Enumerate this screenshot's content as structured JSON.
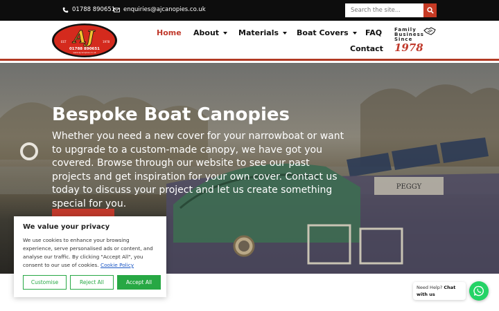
{
  "topbar": {
    "phone": "01788 890651",
    "email": "enquiries@ajcanopies.co.uk",
    "search_placeholder": "Search the site...",
    "icons": [
      "phone-icon",
      "envelope-icon",
      "search-icon"
    ]
  },
  "logo": {
    "text": "AJ",
    "est_left": "EST",
    "est_right": "1978",
    "phone": "01788 890651",
    "url": "www.ajcanopies.co.uk"
  },
  "nav": {
    "home": "Home",
    "about": "About",
    "materials": "Materials",
    "boat_covers": "Boat Covers",
    "faq": "FAQ",
    "contact": "Contact"
  },
  "tagline": {
    "line1": "Family",
    "line2": "Business",
    "line3": "Since",
    "year": "1978"
  },
  "hero": {
    "title": "Bespoke Boat Canopies",
    "text": "Whether you need a new cover for your narrowboat or want to upgrade to a custom-made canopy, we have got you covered. Browse through our website to see our past projects and get inspiration for your own cover. Contact us today to discuss your project and let us create something special for you.",
    "boat_name": "PEGGY"
  },
  "cookie": {
    "title": "We value your privacy",
    "text": "We use cookies to enhance your browsing experience, serve personalised ads or content, and analyse our traffic. By clicking \"Accept All\", you consent to our use of cookies.",
    "link": "Cookie Policy",
    "customise": "Customise",
    "reject": "Reject All",
    "accept": "Accept All"
  },
  "whatsapp": {
    "prefix": "Need Help?",
    "bold": "Chat with us"
  },
  "colors": {
    "brand_red": "#c0392b",
    "whatsapp_green": "#25d366",
    "cookie_green": "#27a844",
    "topbar_bg": "#0d0d0d"
  }
}
